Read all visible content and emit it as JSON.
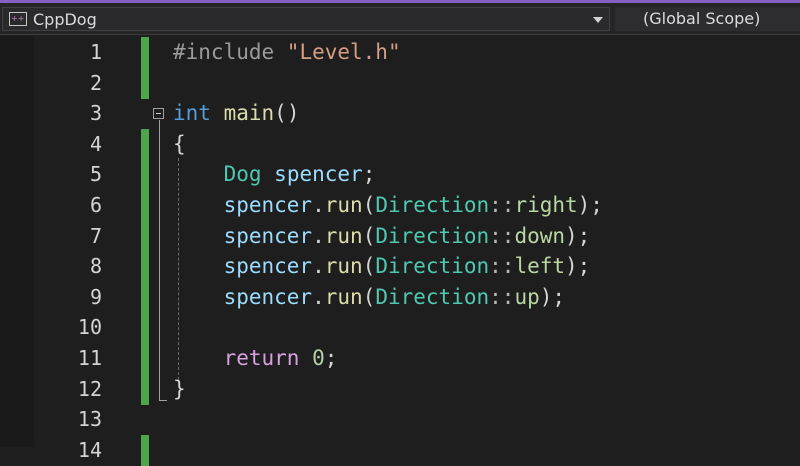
{
  "navbar": {
    "project": "CppDog",
    "scope": "(Global Scope)"
  },
  "editor": {
    "line_numbers": [
      "1",
      "2",
      "3",
      "4",
      "5",
      "6",
      "7",
      "8",
      "9",
      "10",
      "11",
      "12",
      "13",
      "14"
    ],
    "lines": [
      [
        {
          "t": "#include ",
          "c": "pp"
        },
        {
          "t": "\"Level.h\"",
          "c": "str"
        }
      ],
      [],
      [
        {
          "t": "int",
          "c": "kw"
        },
        {
          "t": " ",
          "c": "punc"
        },
        {
          "t": "main",
          "c": "fn"
        },
        {
          "t": "()",
          "c": "punc"
        }
      ],
      [
        {
          "t": "{",
          "c": "punc"
        }
      ],
      [
        {
          "t": "    ",
          "c": "punc"
        },
        {
          "t": "Dog",
          "c": "type"
        },
        {
          "t": " ",
          "c": "punc"
        },
        {
          "t": "spencer",
          "c": "var"
        },
        {
          "t": ";",
          "c": "punc"
        }
      ],
      [
        {
          "t": "    ",
          "c": "punc"
        },
        {
          "t": "spencer",
          "c": "var"
        },
        {
          "t": ".",
          "c": "punc"
        },
        {
          "t": "run",
          "c": "fn"
        },
        {
          "t": "(",
          "c": "punc"
        },
        {
          "t": "Direction",
          "c": "type"
        },
        {
          "t": "::",
          "c": "op"
        },
        {
          "t": "right",
          "c": "enum"
        },
        {
          "t": ");",
          "c": "punc"
        }
      ],
      [
        {
          "t": "    ",
          "c": "punc"
        },
        {
          "t": "spencer",
          "c": "var"
        },
        {
          "t": ".",
          "c": "punc"
        },
        {
          "t": "run",
          "c": "fn"
        },
        {
          "t": "(",
          "c": "punc"
        },
        {
          "t": "Direction",
          "c": "type"
        },
        {
          "t": "::",
          "c": "op"
        },
        {
          "t": "down",
          "c": "enum"
        },
        {
          "t": ");",
          "c": "punc"
        }
      ],
      [
        {
          "t": "    ",
          "c": "punc"
        },
        {
          "t": "spencer",
          "c": "var"
        },
        {
          "t": ".",
          "c": "punc"
        },
        {
          "t": "run",
          "c": "fn"
        },
        {
          "t": "(",
          "c": "punc"
        },
        {
          "t": "Direction",
          "c": "type"
        },
        {
          "t": "::",
          "c": "op"
        },
        {
          "t": "left",
          "c": "enum"
        },
        {
          "t": ");",
          "c": "punc"
        }
      ],
      [
        {
          "t": "    ",
          "c": "punc"
        },
        {
          "t": "spencer",
          "c": "var"
        },
        {
          "t": ".",
          "c": "punc"
        },
        {
          "t": "run",
          "c": "fn"
        },
        {
          "t": "(",
          "c": "punc"
        },
        {
          "t": "Direction",
          "c": "type"
        },
        {
          "t": "::",
          "c": "op"
        },
        {
          "t": "up",
          "c": "enum"
        },
        {
          "t": ");",
          "c": "punc"
        }
      ],
      [],
      [
        {
          "t": "    ",
          "c": "punc"
        },
        {
          "t": "return",
          "c": "ctl"
        },
        {
          "t": " ",
          "c": "punc"
        },
        {
          "t": "0",
          "c": "num"
        },
        {
          "t": ";",
          "c": "punc"
        }
      ],
      [
        {
          "t": "}",
          "c": "punc"
        }
      ],
      [],
      []
    ],
    "changed_lines": [
      1,
      2,
      4,
      5,
      6,
      7,
      8,
      9,
      10,
      11,
      12,
      14
    ]
  },
  "colors": {
    "accent": "#8661c5",
    "change_bar": "#4ca64c",
    "background": "#1e1e1e"
  }
}
